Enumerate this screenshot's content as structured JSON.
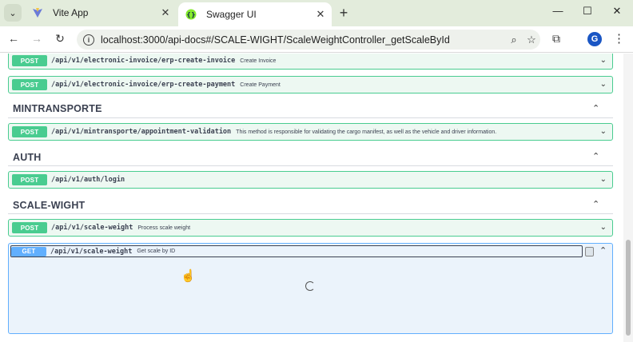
{
  "browser": {
    "tabs": [
      {
        "title": "Vite App",
        "icon": "vite-icon"
      },
      {
        "title": "Swagger UI",
        "icon": "swagger-icon"
      }
    ],
    "address": "localhost:3000/api-docs#/SCALE-WIGHT/ScaleWeightController_getScaleById",
    "profile_initial": "G"
  },
  "operations_top": [
    {
      "method": "POST",
      "path": "/api/v1/electronic-invoice/erp-create-invoice",
      "summary": "Create Invoice"
    },
    {
      "method": "POST",
      "path": "/api/v1/electronic-invoice/erp-create-payment",
      "summary": "Create Payment"
    }
  ],
  "sections": [
    {
      "name": "MINTRANSPORTE",
      "operations": [
        {
          "method": "POST",
          "path": "/api/v1/mintransporte/appointment-validation",
          "summary": "This method is responsible for validating the cargo manifest, as well as the vehicle and driver information."
        }
      ]
    },
    {
      "name": "AUTH",
      "operations": [
        {
          "method": "POST",
          "path": "/api/v1/auth/login",
          "summary": ""
        }
      ]
    },
    {
      "name": "SCALE-WIGHT",
      "operations": [
        {
          "method": "POST",
          "path": "/api/v1/scale-weight",
          "summary": "Process scale weight"
        },
        {
          "method": "GET",
          "path": "/api/v1/scale-weight",
          "summary": "Get scale by ID"
        }
      ]
    }
  ],
  "colors": {
    "post": "#49cc90",
    "get": "#61affe"
  }
}
